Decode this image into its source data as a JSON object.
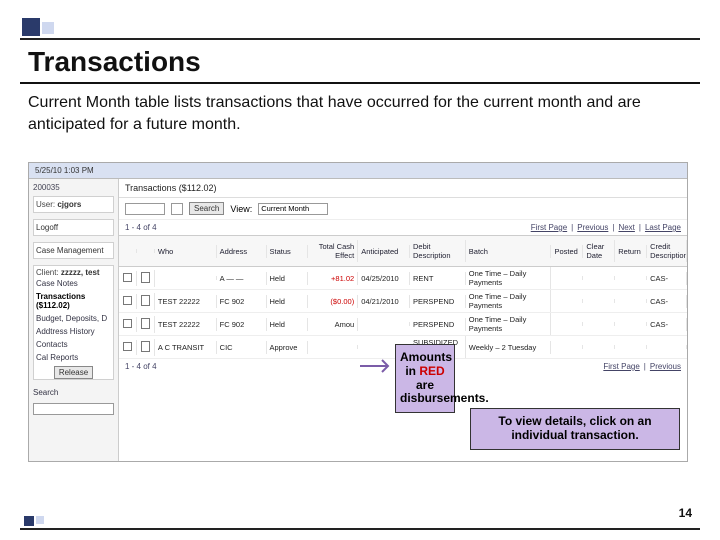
{
  "slide": {
    "title": "Transactions",
    "body": "Current Month table lists transactions that have occurred for the current month and are anticipated for a future month.",
    "page_number": "14"
  },
  "callouts": {
    "box1_line1": "Amounts in",
    "box1_red": "RED",
    "box1_line3": "are disbursements.",
    "box2": "To view details, click on an individual transaction."
  },
  "app": {
    "timestamp": "5/25/10 1:03 PM",
    "id": "200035",
    "header_title": "Transactions ($112.02)",
    "search_btn": "Search",
    "view_label": "View:",
    "view_value": "Current Month",
    "count": "1 - 4 of 4",
    "pager": {
      "first": "First Page",
      "prev": "Previous",
      "next": "Next",
      "last": "Last Page"
    }
  },
  "sidebar": {
    "user_label": "User:",
    "user_value": "cjgors",
    "logoff": "Logoff",
    "case_label": "Case Management",
    "client_label": "Client:",
    "client_value": "zzzzz, test",
    "items": [
      "Case Notes",
      "Transactions ($112.02)",
      "Budget, Deposits, D",
      "Addtress History",
      "Contacts",
      "Cal Reports"
    ],
    "release": "Release",
    "search": "Search"
  },
  "columns": {
    "who": "Who",
    "address": "Address",
    "status": "Status",
    "effect": "Total Cash Effect",
    "anticipated": "Anticipated",
    "debit": "Debit Description",
    "batch": "Batch",
    "posted": "Posted",
    "clear": "Clear Date",
    "return": "Return",
    "credit": "Credit Description"
  },
  "rows": [
    {
      "who": "",
      "addr": "A — —",
      "status": "Held",
      "effect": "+81.02",
      "effect_red": false,
      "antic": "04/25/2010",
      "debit": "RENT",
      "batch": "One Time – Daily Payments",
      "credit": "CAS-"
    },
    {
      "who": "TEST 22222",
      "addr": "FC 902",
      "status": "Held",
      "effect": "($0.00)",
      "effect_red": true,
      "antic": "04/21/2010",
      "debit": "PERSPEND",
      "batch": "One Time – Daily Payments",
      "credit": "CAS-"
    },
    {
      "who": "TEST 22222",
      "addr": "FC 902",
      "status": "Held",
      "effect": "Amou",
      "effect_red": false,
      "antic": "",
      "debit": "PERSPEND",
      "batch": "One Time – Daily Payments",
      "credit": "CAS-"
    },
    {
      "who": "A C TRANSIT",
      "addr": "CIC",
      "status": "Approve",
      "effect": "",
      "effect_red": false,
      "antic": "",
      "debit": "SUBSIDIZED HOUSING",
      "batch": "Weekly – 2 Tuesday",
      "credit": ""
    }
  ]
}
